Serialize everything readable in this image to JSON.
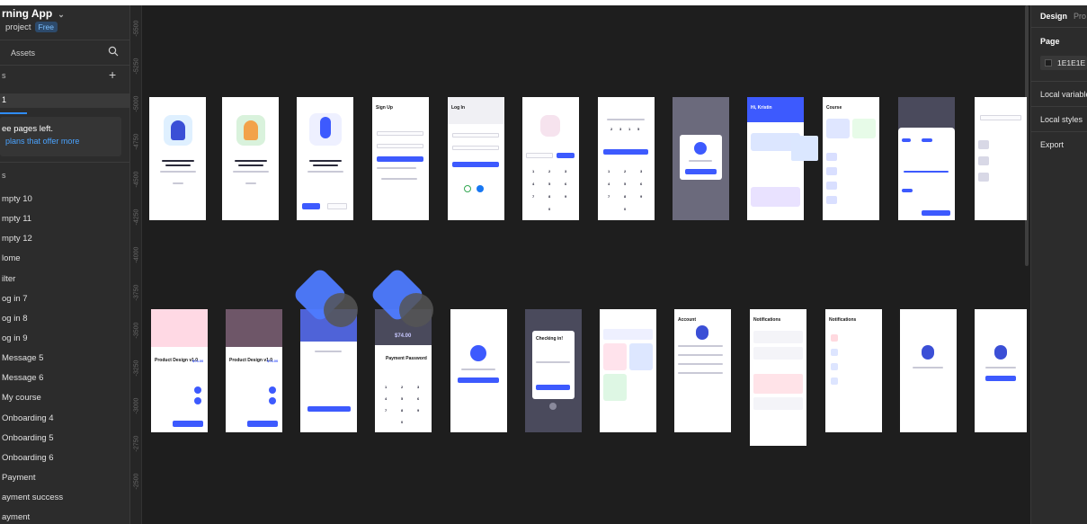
{
  "sidebar": {
    "title": "rning App",
    "project": "project",
    "plan_badge": "Free",
    "assets_label": "Assets",
    "pages_label": "s",
    "current_page": "1",
    "upsell_line1": "ee pages left.",
    "upsell_link": "plans that offer more",
    "layers_label": "s",
    "layers": [
      "mpty 10",
      "mpty 11",
      "mpty 12",
      "lome",
      "ilter",
      "og in 7",
      "og in 8",
      "og in 9",
      "Message 5",
      "Message 6",
      "My course",
      "Onboarding 4",
      "Onboarding 5",
      "Onboarding 6",
      "Payment",
      "ayment success",
      "ayment"
    ]
  },
  "ruler": [
    "-5500",
    "-5250",
    "-5000",
    "-4750",
    "-4500",
    "-4250",
    "-4000",
    "-3750",
    "-3500",
    "-3250",
    "-3000",
    "-2750",
    "-2500"
  ],
  "screens": {
    "signup_title": "Sign Up",
    "login_title": "Log In",
    "course_title": "Course",
    "account_title": "Account",
    "notifications_title_a": "Notifications",
    "notifications_title_b": "Notifications",
    "payment_password": "Payment Password",
    "checking_in": "Checking in!",
    "product_a": "Product Design v1.0",
    "product_b": "Product Design v1.0",
    "price_a": "$74.00",
    "price_b": "$74.00",
    "amount": "$74.00",
    "hi_name": "Hi, Kristin",
    "keypad": [
      "1",
      "2",
      "3",
      "4",
      "5",
      "6",
      "7",
      "8",
      "9",
      "0"
    ]
  },
  "right_panel": {
    "tab_design": "Design",
    "tab_prototype": "Pro",
    "page_label": "Page",
    "page_color": "1E1E1E",
    "local_variables": "Local variable",
    "local_styles": "Local styles",
    "export": "Export"
  },
  "colors": {
    "canvas_bg": "#1e1e1e",
    "panel_bg": "#2c2c2c",
    "accent": "#3d5afe",
    "link": "#4aa3ff"
  }
}
